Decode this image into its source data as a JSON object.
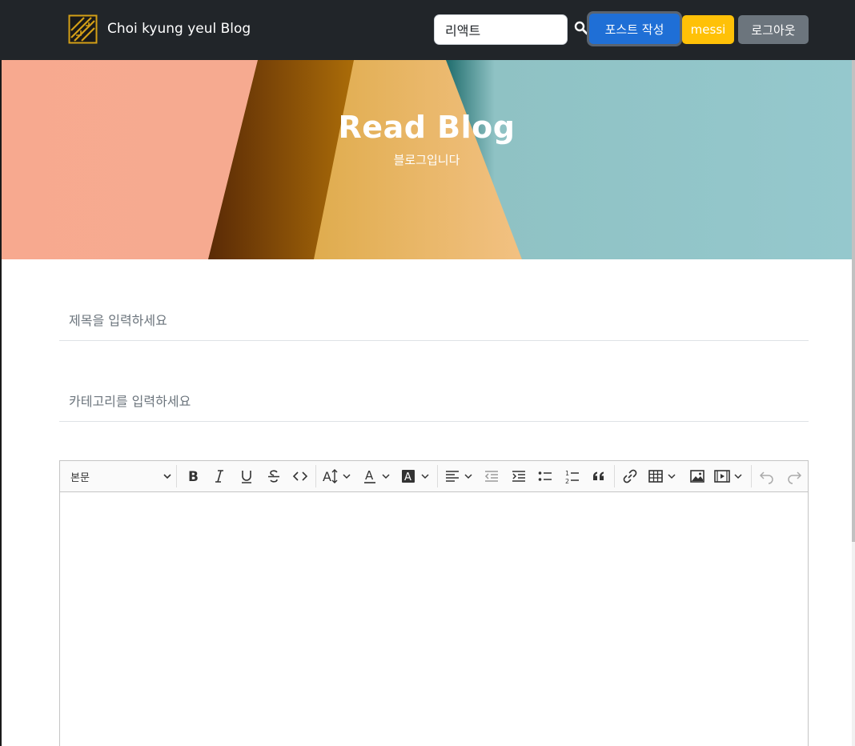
{
  "navbar": {
    "brand": "Choi kyung yeul Blog",
    "search_value": "리액트",
    "write_button": "포스트 작성",
    "user_button": "messi",
    "logout_button": "로그아웃"
  },
  "hero": {
    "title": "Read Blog",
    "subtitle": "블로그입니다"
  },
  "form": {
    "title_placeholder": "제목을 입력하세요",
    "category_placeholder": "카테고리를 입력하세요"
  },
  "editor": {
    "heading_select": "본문",
    "tools": [
      "bold-icon",
      "italic-icon",
      "underline-icon",
      "strikethrough-icon",
      "code-icon",
      "font-size-icon",
      "font-color-icon",
      "highlight-icon",
      "align-icon",
      "outdent-icon",
      "indent-icon",
      "bulleted-list-icon",
      "numbered-list-icon",
      "blockquote-icon",
      "link-icon",
      "table-icon",
      "image-icon",
      "media-icon",
      "undo-icon",
      "redo-icon"
    ]
  },
  "colors": {
    "navbar_bg": "#212529",
    "primary": "#1f6fd6",
    "warning": "#ffc107",
    "secondary": "#6c757d"
  }
}
